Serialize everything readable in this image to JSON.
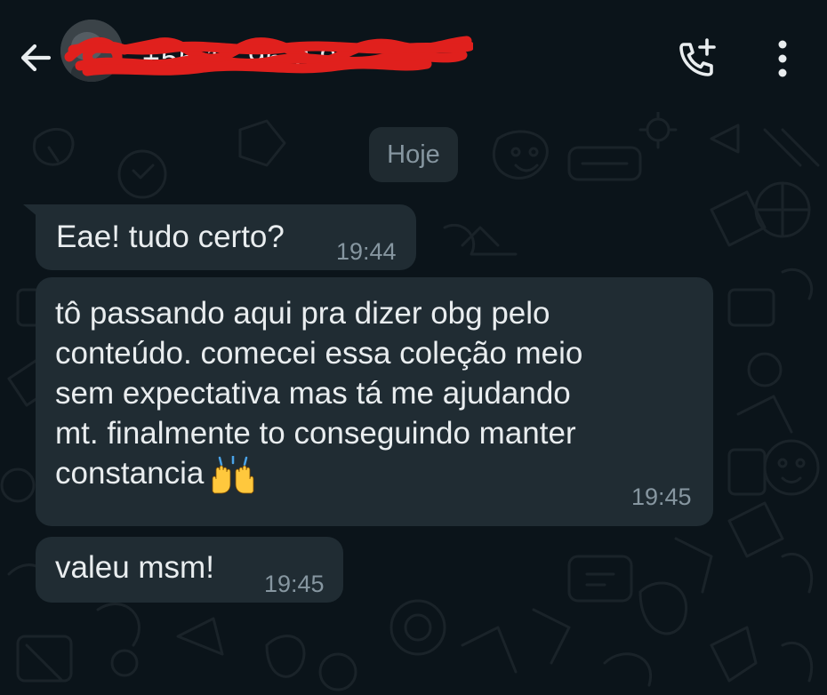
{
  "header": {
    "back_icon": "arrow-back-icon",
    "contact_name": "+55 11 96 2 9 ",
    "contact_name_redacted": true,
    "call_icon": "add-call-icon",
    "menu_icon": "more-vertical-icon"
  },
  "chat": {
    "date_chip": "Hoje",
    "messages": [
      {
        "lines": [
          "Eae! tudo certo?"
        ],
        "time": "19:44"
      },
      {
        "lines": [
          "tô passando aqui pra dizer obg pelo",
          "conteúdo. comecei essa coleção meio",
          "sem expectativa mas tá me ajudando",
          "mt. finalmente to conseguindo manter",
          "constancia"
        ],
        "emoji": "raising-hands-icon",
        "time": "19:45"
      },
      {
        "lines": [
          "valeu msm!"
        ],
        "time": "19:45"
      }
    ]
  },
  "colors": {
    "background": "#0b141a",
    "bubble_incoming": "#202c33",
    "text_primary": "#e9edef",
    "text_secondary": "#8696a0",
    "redaction": "#e0201d"
  }
}
